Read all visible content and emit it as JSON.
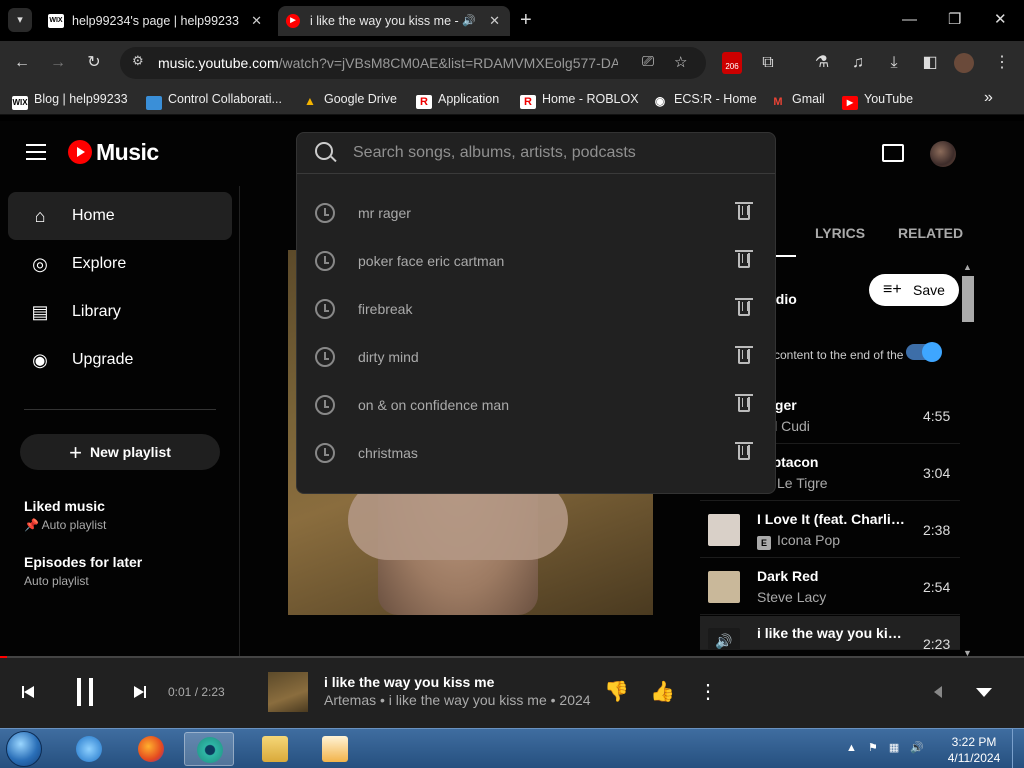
{
  "browser": {
    "tabs": [
      {
        "favicon": "WIX",
        "title": "help99234's page | help99233",
        "close": "✕"
      },
      {
        "favicon": "▶",
        "title": "i like the way you kiss me -",
        "close": "✕",
        "audio_icon": "speaker-icon"
      }
    ],
    "new_tab": "+",
    "window_controls": {
      "minimize": "—",
      "maximize": "❐",
      "close": "✕"
    },
    "url": {
      "host": "music.youtube.com",
      "path": "/watch?v=jVBsM8CM0AE&list=RDAMVMXEolg577-DA"
    },
    "ext_badge": "206",
    "bookmarks": [
      {
        "icon": "WIX",
        "label": "Blog | help99233"
      },
      {
        "icon": "▬",
        "label": "Control Collaborati..."
      },
      {
        "icon": "▲",
        "label": "Google Drive"
      },
      {
        "icon": "R",
        "label": "Application"
      },
      {
        "icon": "R",
        "label": "Home - ROBLOX"
      },
      {
        "icon": "◉",
        "label": "ECS:R - Home"
      },
      {
        "icon": "M",
        "label": "Gmail"
      },
      {
        "icon": "▶",
        "label": "YouTube"
      }
    ],
    "bookmarks_more": "»"
  },
  "app": {
    "logo_text": "Music",
    "search": {
      "placeholder": "Search songs, albums, artists, podcasts",
      "history": [
        "mr rager",
        "poker face eric cartman",
        "firebreak",
        "dirty mind",
        "on & on confidence man",
        "christmas"
      ]
    },
    "nav": [
      {
        "icon": "⌂",
        "label": "Home"
      },
      {
        "icon": "◎",
        "label": "Explore"
      },
      {
        "icon": "▤",
        "label": "Library"
      },
      {
        "icon": "◉",
        "label": "Upgrade"
      }
    ],
    "new_playlist": "New playlist",
    "playlists": [
      {
        "title": "Liked music",
        "subtitle": "Auto playlist",
        "pinned": true
      },
      {
        "title": "Episodes for later",
        "subtitle": "Auto playlist",
        "pinned": false
      }
    ],
    "right_panel": {
      "tabs": [
        "LYRICS",
        "RELATED"
      ],
      "radio_label": "adio",
      "save_label": "Save",
      "autoplay_text": "content to the end of the",
      "queue": [
        {
          "title": "Rager",
          "artist": "Kid Cudi",
          "duration": "4:55",
          "explicit": false,
          "thumb": "#3a3a3a"
        },
        {
          "title": "ceptacon",
          "artist": "Le Tigre",
          "duration": "3:04",
          "explicit": true,
          "thumb": "#2e2e2e"
        },
        {
          "title": "I Love It (feat. Charli XCX)",
          "artist": "Icona Pop",
          "duration": "2:38",
          "explicit": true,
          "thumb": "#d9d0c8"
        },
        {
          "title": "Dark Red",
          "artist": "Steve Lacy",
          "duration": "2:54",
          "explicit": false,
          "thumb": "#c9b89a"
        },
        {
          "title": "i like the way you kiss me",
          "artist": "Artemas",
          "duration": "2:23",
          "explicit": false,
          "thumb": "#1a1a1a",
          "playing": true
        }
      ]
    },
    "player": {
      "time": "0:01 / 2:23",
      "progress": 0.007,
      "title": "i like the way you kiss me",
      "subtitle": "Artemas • i like the way you kiss me • 2024"
    }
  },
  "taskbar": {
    "time": "3:22 PM",
    "date": "4/11/2024"
  },
  "colors": {
    "accent": "#ff0000",
    "toggle": "#3ea6ff",
    "panel": "#212121"
  }
}
